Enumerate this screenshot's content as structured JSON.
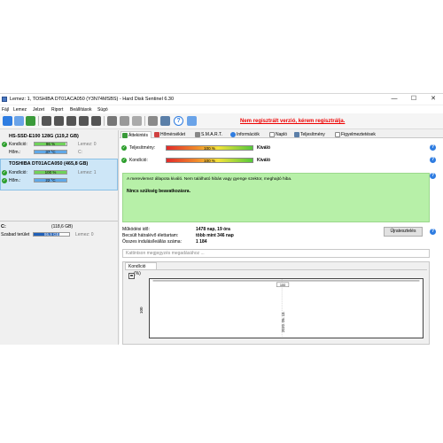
{
  "window": {
    "title": "Lemez: 1, TOSHIBA DT01ACA050 (Y3N74MSBS)  -  Hard Disk Sentinel 6.30",
    "minimize": "—",
    "maximize": "☐",
    "close": "✕"
  },
  "menu": [
    "Fájl",
    "Lemez",
    "Jelzet",
    "Riport",
    "Beállítások",
    "Súgó"
  ],
  "toolbar": {
    "warning": "Nem regisztrált verzió, kérem regisztrálja."
  },
  "disks": [
    {
      "title": "HS-SSD-E100 128G (119,2 GB)",
      "health_label": "Kondíció:",
      "health_value": "96 %",
      "health_pct": 96,
      "health_extra": "Lemez: 0",
      "temp_label": "Hőm.:",
      "temp_value": "37 °C",
      "temp_extra": "C:"
    },
    {
      "title": "TOSHIBA DT01ACA050 (465,8 GB)",
      "health_label": "Kondíció:",
      "health_value": "100 %",
      "health_pct": 100,
      "health_extra": "Lemez: 1",
      "temp_label": "Hőm.:",
      "temp_value": "22 °C",
      "temp_extra": ""
    }
  ],
  "partition": {
    "name": "C:",
    "size": "(118,6 GB)",
    "free_label": "Szabad terület",
    "free_value": "86,9 GB",
    "free_pct": 73,
    "disk": "Lemez: 0"
  },
  "tabs": [
    "Áttekintés",
    "Hőmérséklet",
    "S.M.A.R.T.",
    "Információk",
    "Napló",
    "Teljesítmény",
    "Figyelmeztetések"
  ],
  "status": {
    "performance_label": "Teljesítmény:",
    "performance_value": "100 %",
    "performance_text": "Kiváló",
    "health_label": "Kondíció:",
    "health_value": "100 %",
    "health_text": "Kiváló"
  },
  "message": {
    "text": "A merevlemez állapota kiváló. Nem található hibás vagy gyenge szektor, meghajtó hiba.",
    "action": "Nincs szükség beavatkozásra."
  },
  "info": [
    {
      "label": "Működési idő:",
      "value": "1478 nap, 19 óra"
    },
    {
      "label": "Becsült hátralévő élettartam:",
      "value": "több mint 346 nap"
    },
    {
      "label": "Összes indulás/leállás száma:",
      "value": "1 184"
    }
  ],
  "repeat_button": "Újratesztelés",
  "comment_placeholder": "Kattintson megjegyzés megadásához ...",
  "graph": {
    "tab": "Kondíció",
    "unit": "(%)",
    "ylabel": "100",
    "point_label": "100",
    "date": "2020. 05. 13."
  },
  "chart_data": {
    "type": "line",
    "x": [
      "2020. 05. 13."
    ],
    "series": [
      {
        "values": [
          100
        ]
      }
    ],
    "ylim": [
      100,
      100
    ]
  }
}
